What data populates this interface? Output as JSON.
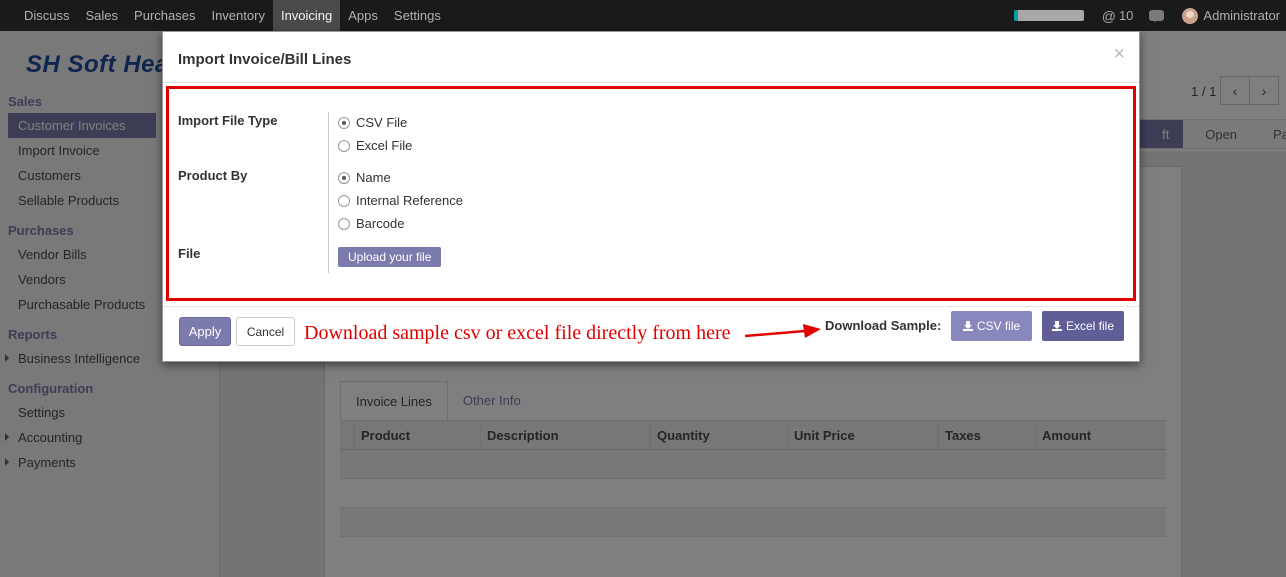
{
  "navbar": {
    "menu": [
      "Discuss",
      "Sales",
      "Purchases",
      "Inventory",
      "Invoicing",
      "Apps",
      "Settings"
    ],
    "active_index": 4,
    "mention_count": "10",
    "user": "Administrator"
  },
  "sidebar": {
    "logo": "SH Soft Hea",
    "sections": {
      "sales": "Sales",
      "purchases": "Purchases",
      "reports": "Reports",
      "configuration": "Configuration"
    },
    "sales_items": [
      "Customer Invoices",
      "Import Invoice",
      "Customers",
      "Sellable Products"
    ],
    "purchase_items": [
      "Vendor Bills",
      "Vendors",
      "Purchasable Products"
    ],
    "report_items": [
      "Business Intelligence"
    ],
    "config_items": [
      "Settings",
      "Accounting",
      "Payments"
    ]
  },
  "control_panel": {
    "pager": "1 / 1",
    "status_steps": [
      "Draft",
      "Open",
      "Paid"
    ],
    "status_visible": [
      "ft",
      "Open",
      "Paid"
    ]
  },
  "form": {
    "tabs": [
      "Invoice Lines",
      "Other Info"
    ],
    "columns": [
      "Product",
      "Description",
      "Quantity",
      "Unit Price",
      "Taxes",
      "Amount"
    ]
  },
  "modal": {
    "title": "Import Invoice/Bill Lines",
    "close": "×",
    "fields": {
      "import_file_type": {
        "label": "Import File Type",
        "options": [
          "CSV File",
          "Excel File"
        ],
        "selected": "CSV File"
      },
      "product_by": {
        "label": "Product By",
        "options": [
          "Name",
          "Internal Reference",
          "Barcode"
        ],
        "selected": "Name"
      },
      "file": {
        "label": "File",
        "upload_label": "Upload your file"
      }
    },
    "footer": {
      "apply": "Apply",
      "cancel": "Cancel",
      "annotation": "Download sample csv or excel file directly from here",
      "download_label": "Download Sample:",
      "csv_button": "CSV file",
      "excel_button": "Excel file"
    }
  },
  "colors": {
    "accent": "#7c7bad",
    "annotation_red": "#e00000",
    "navbar": "#1a1a1a"
  }
}
